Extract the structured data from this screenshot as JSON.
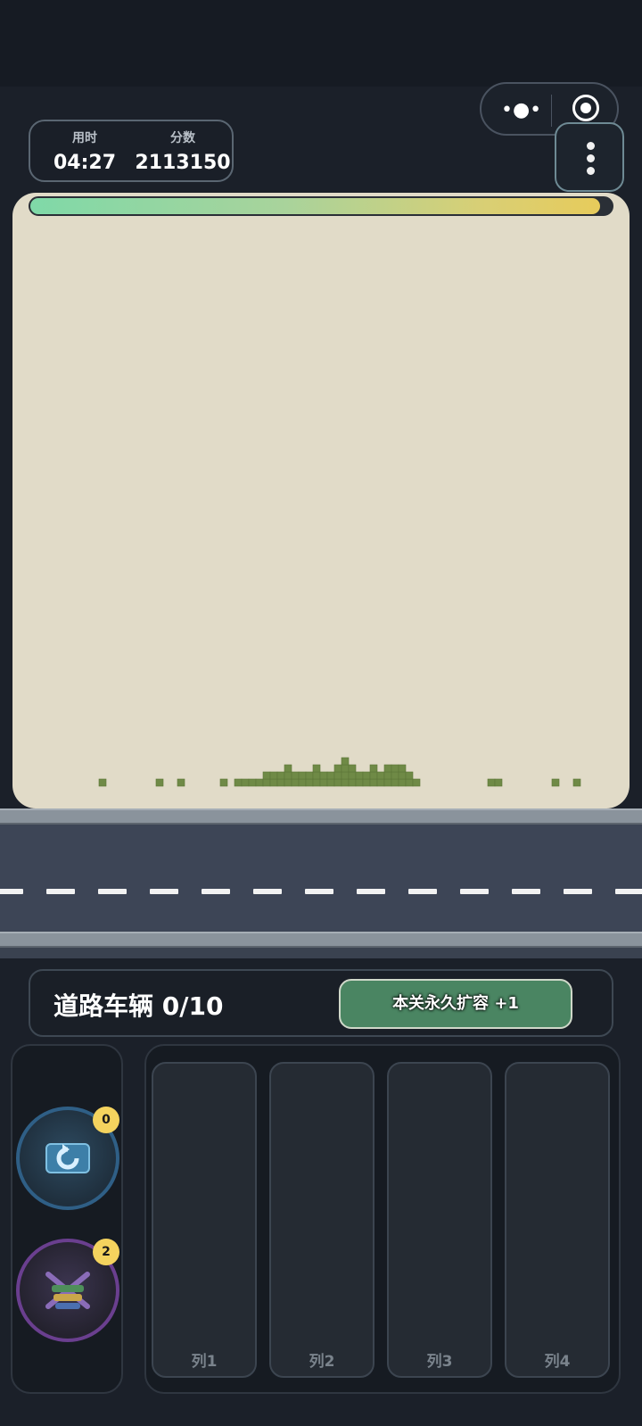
{
  "stats": {
    "time_label": "用时",
    "time_value": "04:27",
    "score_label": "分数",
    "score_value": "2113150"
  },
  "progress": {
    "fraction": 0.98
  },
  "road": {
    "label": "道路车辆 0/10"
  },
  "expand_button": {
    "label": "本关永久扩容 +1"
  },
  "tools": [
    {
      "icon": "undo-ticket-icon",
      "count": "0"
    },
    {
      "icon": "shuffle-cars-icon",
      "count": "2"
    }
  ],
  "columns": [
    {
      "label": "列1"
    },
    {
      "label": "列2"
    },
    {
      "label": "列3"
    },
    {
      "label": "列4"
    }
  ],
  "colors": {
    "board": "#e1dbc8",
    "brick": "#6f8a46",
    "expand_button": "#4a8562",
    "badge": "#f4d35e"
  }
}
